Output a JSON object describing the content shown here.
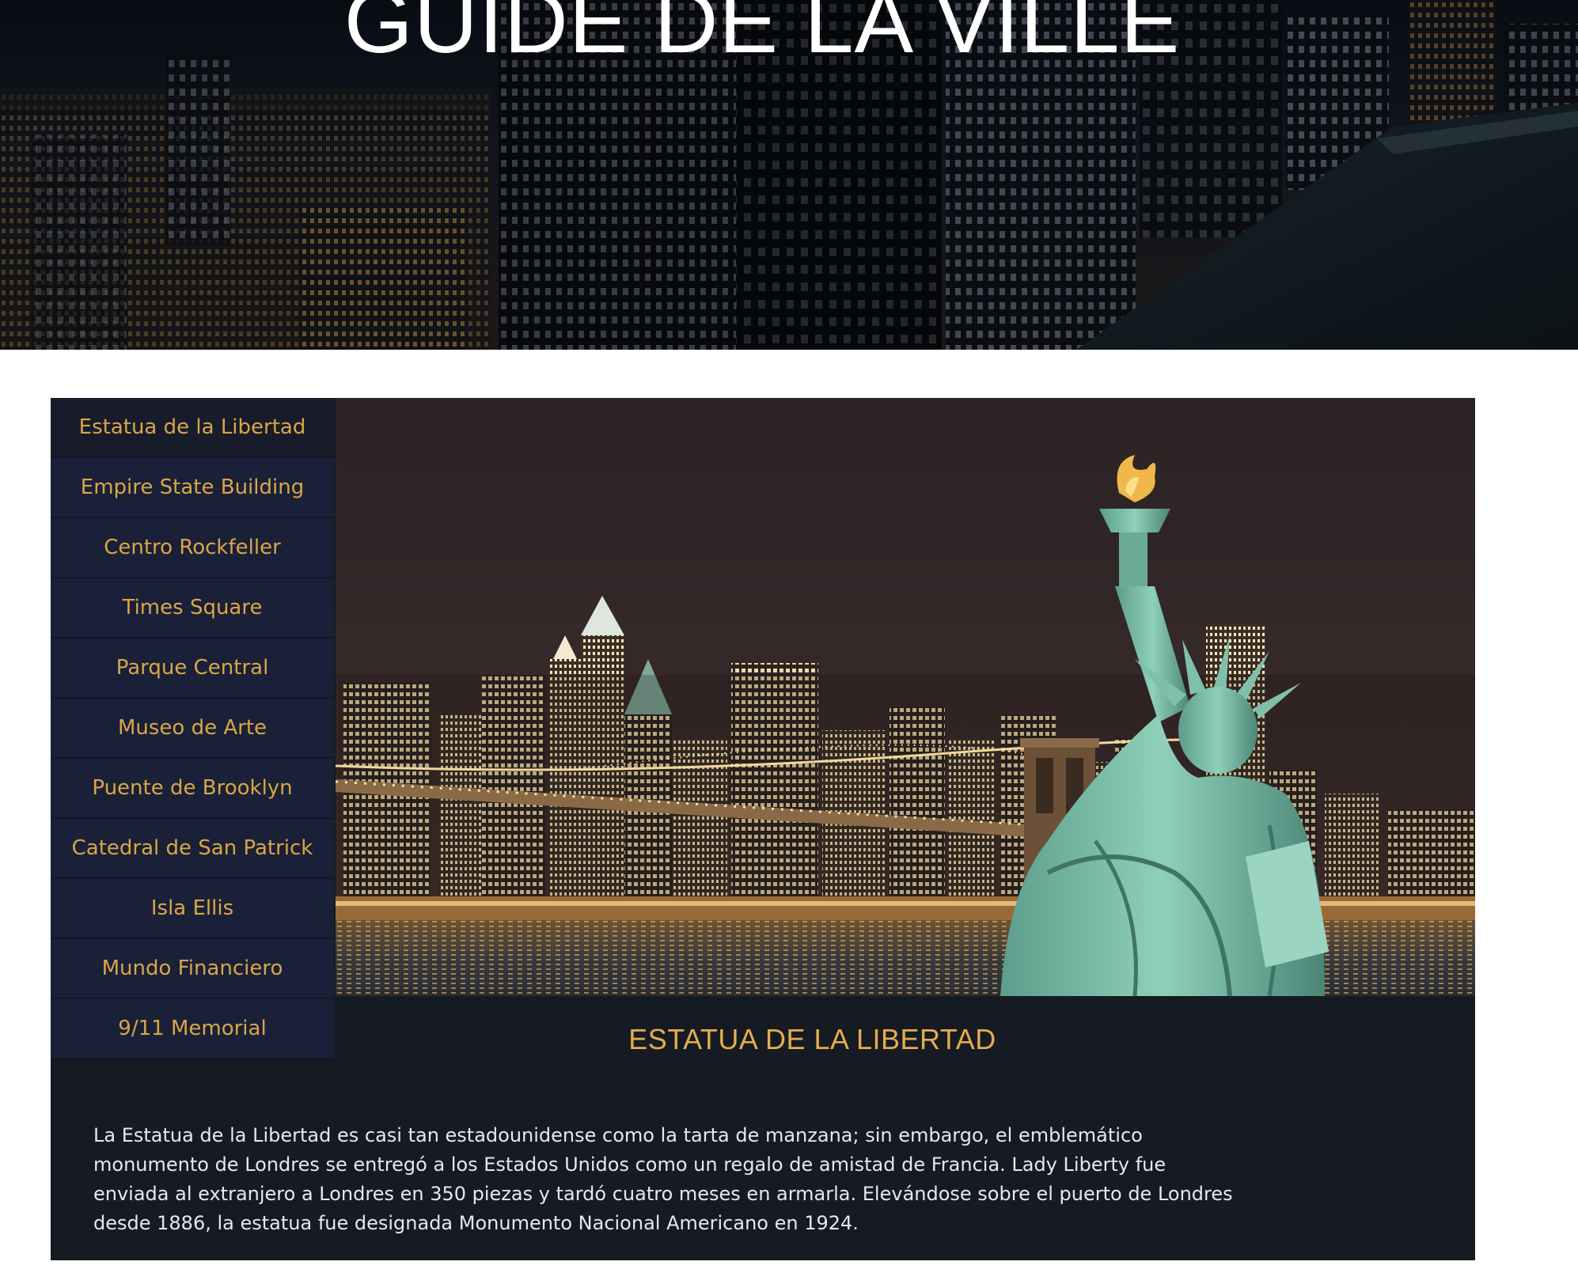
{
  "header": {
    "title": "GUIDE DE LA VILLE"
  },
  "nav": {
    "items": [
      {
        "label": "Estatua de la Libertad",
        "active": true
      },
      {
        "label": "Empire State Building",
        "active": false
      },
      {
        "label": "Centro Rockfeller",
        "active": false
      },
      {
        "label": "Times Square",
        "active": false
      },
      {
        "label": "Parque Central",
        "active": false
      },
      {
        "label": "Museo de Arte",
        "active": false
      },
      {
        "label": "Puente de Brooklyn",
        "active": false
      },
      {
        "label": "Catedral de San Patrick",
        "active": false
      },
      {
        "label": "Isla Ellis",
        "active": false
      },
      {
        "label": "Mundo Financiero",
        "active": false
      },
      {
        "label": "9/11 Memorial",
        "active": false
      }
    ]
  },
  "content": {
    "title": "ESTATUA DE LA LIBERTAD",
    "description": "La Estatua de la Libertad es casi tan estadounidense como la tarta de manzana; sin embargo, el emblemático monumento de Londres se entregó a los Estados Unidos como un regalo de amistad de Francia. Lady Liberty fue enviada al extranjero a Londres en 350 piezas y tardó cuatro meses en armarla. Elevándose sobre el puerto de Londres desde 1886, la estatua fue designada Monumento Nacional Americano en 1924."
  },
  "colors": {
    "accent": "#d9a646",
    "nav_bg": "#1a2038",
    "panel_bg": "#161a23",
    "text": "#e6e8ee"
  },
  "icons": {
    "hero": "night-city-skyline-image",
    "photo": "brooklyn-bridge-statue-of-liberty-image"
  }
}
